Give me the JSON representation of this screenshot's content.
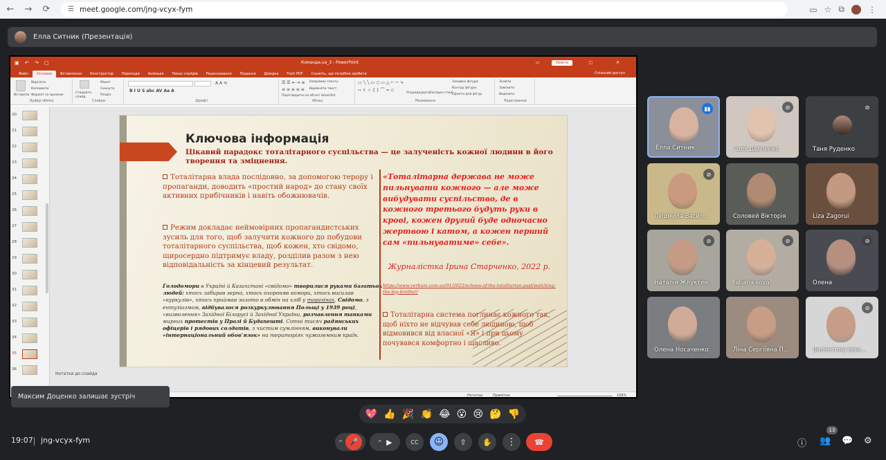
{
  "browser": {
    "url": "meet.google.com/jng-vcyx-fym",
    "back_icon": "←",
    "forward_icon": "→",
    "reload_icon": "⟳"
  },
  "meeting": {
    "presenter_label": "Елла Ситник (Презентація)",
    "time": "19:07",
    "code": "jng-vcyx-fym",
    "participants_count": "13"
  },
  "ppt": {
    "doc_title": "Команда.ua_3  -  PowerPoint",
    "login_label": "Увійти",
    "share_label": "Спільний доступ",
    "tabs": [
      "Файл",
      "Основне",
      "Вставлення",
      "Конструктор",
      "Переходи",
      "Анімація",
      "Показ слайдів",
      "Рецензування",
      "Подання",
      "Довідка",
      "Foxit PDF",
      "Скажіть, що потрібно зробити"
    ],
    "ribbon": {
      "paste": "Вставити",
      "cut": "Вирізати",
      "copy": "Копіювати",
      "format_painter": "Формат за зразком",
      "clipboard_group": "Буфер обміну",
      "new_slide": "Створити слайд",
      "layout": "Макет",
      "reset": "Скинути",
      "section": "Розділ",
      "slides_group": "Слайди",
      "font_group": "Шрифт",
      "text_dir": "Напрямок тексту",
      "align_text": "Вирівняти текст",
      "smartart": "Перетворити на об'єкт SmartArt",
      "paragraph_group": "Абзац",
      "arrange": "Упорядкувати",
      "quick_styles": "Експрес-стилі",
      "shape_fill": "Заливка фігури",
      "shape_outline": "Контур фігури",
      "shape_effects": "Ефекти для фігур",
      "drawing_group": "Малювання",
      "find": "Знайти",
      "replace": "Замінити",
      "select": "Виділити",
      "editing_group": "Редагування"
    },
    "thumb_numbers": [
      "20",
      "21",
      "22",
      "23",
      "24",
      "25",
      "26",
      "27",
      "28",
      "29",
      "30",
      "31",
      "32",
      "33",
      "34",
      "35",
      "36"
    ],
    "selected_thumb": "35",
    "notes_label": "Нотатки до слайда",
    "status_notes": "Нотатки",
    "status_comments": "Примітки",
    "zoom": "108%"
  },
  "slide": {
    "title": "Ключова інформація",
    "subtitle": "Цікавий парадокс тоталітарного суспільства — це залученість кожної людини в його творення та зміцнення.",
    "bullet1": "Тоталітарна влада послідовно, за допомогою терору і пропаганди, доводить «простий народ» до стану своїх активних прибічників і навіть обожнювачів.",
    "bullet2": "Режим докладає неймовірних пропагандистських зусиль для того, щоб залучити кожного до побудови тоталітарного суспільства, щоб кожен, хто свідомо, щиросердно підтримує владу, розділив разом з нею відповідальність за кінцевий результат.",
    "para_parts": [
      "Голодомори",
      " в Україні й Казахстані «свідомо» ",
      "творилися руками багатьох людей:",
      " хтось забирав зерно, хтось охороняв комори, хтось висилав «куркулів», хтось приймав золото в обмін на хліб у ",
      "торгзінах",
      ". ",
      "Свідомо",
      ", з ентузіазмом, ",
      "відбувалося розкуркулювання Польщі у 1939 році",
      ", «визволення» Західної Білорусі й Західної України, ",
      "розчавлення танками",
      " мирних ",
      "протестів у Празі й Будапешті",
      ". Сотні тисяч ",
      "радянських офіцерів і рядових солдатів",
      ", з чистим сумлінням, ",
      "виконували «інтернаціональний обов'язок»",
      " на територіях чужоземним країн."
    ],
    "quote": "«Тоталітарна держава не може пильнувати кожного — але може вибудувати суспільство, де в кожного третього будуть руки в крові, кожен другий буде одночасно жертвою і катом, а кожен перший сам «пильнуватиме» себе».",
    "quote_author": "Журналістка Ірина Старченко, 2022 р.",
    "quote_link": "https://www.verbum.com.ua/01/2022/echoes-of-the-totalitarian-past/watching-the-big-brother/",
    "bullet3": "Тоталітарна система поглинає кожного так, щоб ніхто не відчував себе людиною, щоб відмовився від власної «Я» і при цьому почувався комфортно і щасливо."
  },
  "toast": "Максим Доценко залишає зустріч",
  "participants": [
    {
      "name": "Елла Ситник",
      "mic": "speaking",
      "bg": "#8a8f9a",
      "face": "#d8b4a0"
    },
    {
      "name": "Галя Дьяченко",
      "mic": "muted",
      "bg": "#cfc7c0",
      "face": "#e2c3ad"
    },
    {
      "name": "Таня Руденко",
      "mic": "muted",
      "bg": "#3c4043",
      "face": ""
    },
    {
      "name": "Людмила Васил...",
      "mic": "muted",
      "bg": "#c9b98a",
      "face": "#c99a80"
    },
    {
      "name": "Соловей Вікторія",
      "mic": "",
      "bg": "#5a5c58",
      "face": "#b08a72"
    },
    {
      "name": "Liza Zagorui",
      "mic": "",
      "bg": "#6b4f3e",
      "face": "#c29a82"
    },
    {
      "name": "Наталія Жлуктен...",
      "mic": "muted",
      "bg": "#a7a59c",
      "face": "#c69b86"
    },
    {
      "name": "tatiana koval",
      "mic": "muted",
      "bg": "#b3aca2",
      "face": "#d7b09a"
    },
    {
      "name": "Олена",
      "mic": "muted",
      "bg": "#4a4b52",
      "face": "#b58f7f"
    },
    {
      "name": "Олена Носаченко",
      "mic": "",
      "bg": "#7b7d80",
      "face": "#d0ab98"
    },
    {
      "name": "Ліна Сергіївна П...",
      "mic": "",
      "bg": "#9c8c80",
      "face": "#c79d86"
    },
    {
      "name": "Валентина Іван...",
      "mic": "muted",
      "bg": "#d6d6d6",
      "face": "#c89d88"
    }
  ],
  "reactions": [
    "💖",
    "👍",
    "🎉",
    "👏",
    "😂",
    "😮",
    "😢",
    "🤔",
    "👎"
  ],
  "controls": {
    "mic_icon": "🎤",
    "cam_icon": "▶",
    "captions_icon": "CC",
    "emoji_icon": "☺",
    "present_icon": "⇧",
    "hand_icon": "✋",
    "more_icon": "⋮",
    "hangup_icon": "☎",
    "info_icon": "ⓘ",
    "people_icon": "👥",
    "chat_icon": "💬",
    "activities_icon": "⚙"
  }
}
